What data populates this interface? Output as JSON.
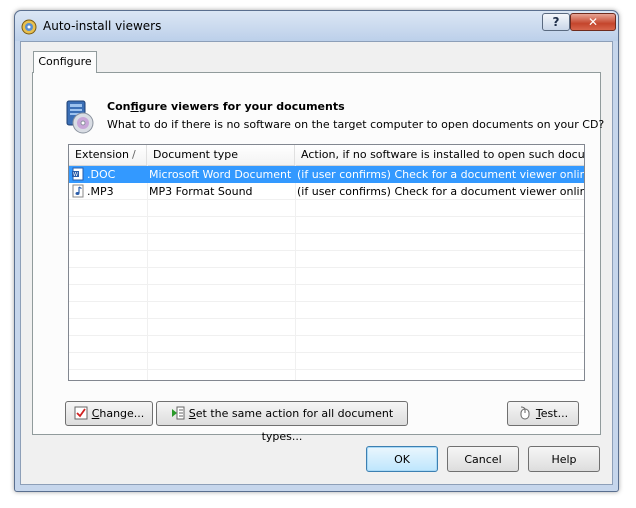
{
  "window": {
    "title": "Auto-install viewers",
    "help_button": "?",
    "close_button": "✕"
  },
  "tabs": [
    {
      "label": "Configure",
      "active": true
    }
  ],
  "header": {
    "title_pre": "Con",
    "title_mn": "f",
    "title_post": "igure viewers for your documents",
    "subtitle": "What to do if there is no software on the target computer to open documents on your CD?"
  },
  "list": {
    "columns": [
      {
        "label": "Extension",
        "sort": "/"
      },
      {
        "label": "Document type"
      },
      {
        "label": "Action, if no software is installed to open such docume..."
      }
    ],
    "rows": [
      {
        "extension": ".DOC",
        "type": "Microsoft Word Document",
        "action": "(if user confirms) Check for a document viewer online ...",
        "icon": "word-doc-icon",
        "selected": true
      },
      {
        "extension": ".MP3",
        "type": "MP3 Format Sound",
        "action": "(if user confirms) Check for a document viewer online ...",
        "icon": "audio-note-icon",
        "selected": false
      }
    ]
  },
  "buttons": {
    "change_mn": "C",
    "change_rest": "hange...",
    "same_mn": "S",
    "same_rest": "et the same action for all document types...",
    "test_mn": "T",
    "test_rest": "est...",
    "ok": "OK",
    "cancel": "Cancel",
    "help": "Help"
  },
  "colors": {
    "selection": "#3399ff",
    "window_frame": "#c6d6ec"
  }
}
